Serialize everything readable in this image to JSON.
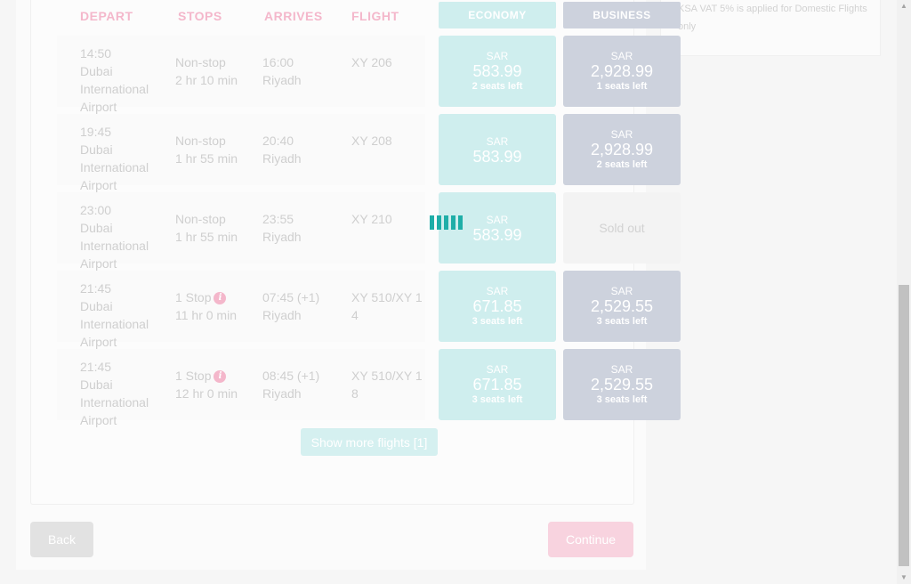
{
  "headers": {
    "depart": "DEPART",
    "stops": "STOPS",
    "arrives": "ARRIVES",
    "flight": "FLIGHT",
    "economy": "ECONOMY",
    "business": "BUSINESS"
  },
  "vat_note": "KSA VAT 5% is applied for Domestic Flights only",
  "flights": [
    {
      "depart_time": "14:50",
      "depart_airport": "Dubai International Airport",
      "stops": "Non-stop",
      "stop_info": false,
      "duration": "2 hr 10 min",
      "arrive_time": "16:00",
      "arrive_city": "Riyadh",
      "flight_no": "XY 206",
      "economy": {
        "currency": "SAR",
        "amount": "583.99",
        "seats": "2 seats left"
      },
      "business": {
        "currency": "SAR",
        "amount": "2,928.99",
        "seats": "1 seats left",
        "sold_out": false
      }
    },
    {
      "depart_time": "19:45",
      "depart_airport": "Dubai International Airport",
      "stops": "Non-stop",
      "stop_info": false,
      "duration": "1 hr 55 min",
      "arrive_time": "20:40",
      "arrive_city": "Riyadh",
      "flight_no": "XY 208",
      "economy": {
        "currency": "SAR",
        "amount": "583.99",
        "seats": ""
      },
      "business": {
        "currency": "SAR",
        "amount": "2,928.99",
        "seats": "2 seats left",
        "sold_out": false
      }
    },
    {
      "depart_time": "23:00",
      "depart_airport": "Dubai International Airport",
      "stops": "Non-stop",
      "stop_info": false,
      "duration": "1 hr 55 min",
      "arrive_time": "23:55",
      "arrive_city": "Riyadh",
      "flight_no": "XY 210",
      "economy": {
        "currency": "SAR",
        "amount": "583.99",
        "seats": ""
      },
      "business": {
        "sold_out": true,
        "sold_label": "Sold out"
      }
    },
    {
      "depart_time": "21:45",
      "depart_airport": "Dubai International Airport",
      "stops": "1 Stop",
      "stop_info": true,
      "duration": "11 hr 0 min",
      "arrive_time": "07:45 (+1)",
      "arrive_city": "Riyadh",
      "flight_no": "XY 510/XY 14",
      "economy": {
        "currency": "SAR",
        "amount": "671.85",
        "seats": "3 seats left"
      },
      "business": {
        "currency": "SAR",
        "amount": "2,529.55",
        "seats": "3 seats left",
        "sold_out": false
      }
    },
    {
      "depart_time": "21:45",
      "depart_airport": "Dubai International Airport",
      "stops": "1 Stop",
      "stop_info": true,
      "duration": "12 hr 0 min",
      "arrive_time": "08:45 (+1)",
      "arrive_city": "Riyadh",
      "flight_no": "XY 510/XY 18",
      "economy": {
        "currency": "SAR",
        "amount": "671.85",
        "seats": "3 seats left"
      },
      "business": {
        "currency": "SAR",
        "amount": "2,529.55",
        "seats": "3 seats left",
        "sold_out": false
      }
    }
  ],
  "info_icon_glyph": "i",
  "show_more_label": "Show more flights [1]",
  "back_label": "Back",
  "continue_label": "Continue",
  "colors": {
    "accent_teal": "#1faea8",
    "economy_bg": "#cfeeee",
    "business_bg": "#cdd2dd",
    "pink_accent": "#f4b7cb"
  }
}
